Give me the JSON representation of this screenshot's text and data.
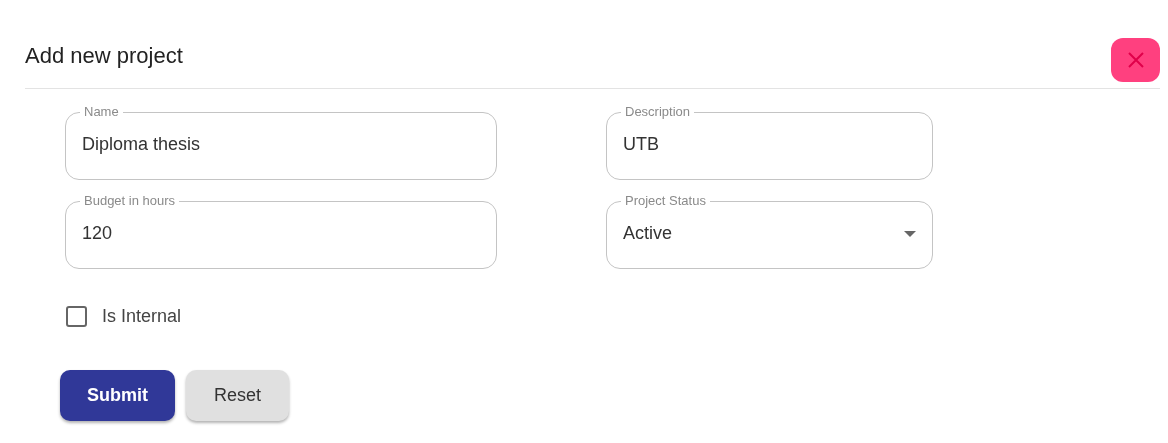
{
  "dialog": {
    "title": "Add new project"
  },
  "fields": [
    {
      "kind": "text",
      "label": "Name",
      "value": "Diploma thesis"
    },
    {
      "kind": "text",
      "label": "Description",
      "value": "UTB"
    },
    {
      "kind": "text",
      "label": "Budget in hours",
      "value": "120"
    },
    {
      "kind": "select",
      "label": "Project Status",
      "value": "Active"
    }
  ],
  "checkbox": {
    "label": "Is Internal",
    "checked": false
  },
  "buttons": [
    {
      "kind": "primary",
      "label": "Submit"
    },
    {
      "kind": "secondary",
      "label": "Reset"
    }
  ]
}
